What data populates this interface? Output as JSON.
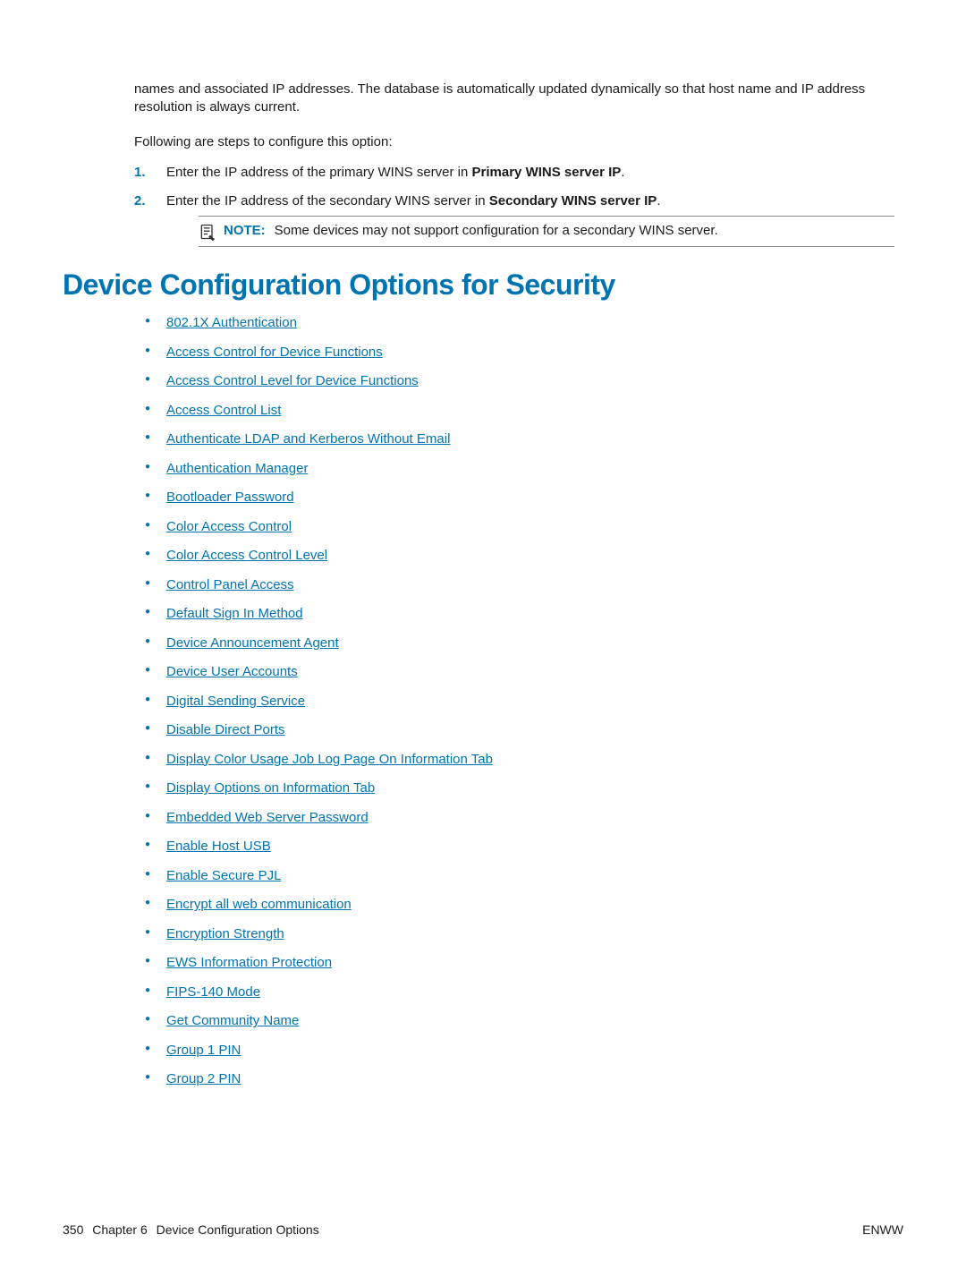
{
  "intro": {
    "paragraph1": "names and associated IP addresses. The database is automatically updated dynamically so that host name and IP address resolution is always current.",
    "paragraph2": "Following are steps to configure this option:"
  },
  "steps": [
    {
      "prefix": "Enter the IP address of the primary WINS server in ",
      "bold": "Primary WINS server IP",
      "suffix": "."
    },
    {
      "prefix": "Enter the IP address of the secondary WINS server in ",
      "bold": "Secondary WINS server IP",
      "suffix": "."
    }
  ],
  "note": {
    "label": "NOTE:",
    "text": "Some devices may not support configuration for a secondary WINS server."
  },
  "section_title": "Device Configuration Options for Security",
  "links": [
    "802.1X Authentication",
    "Access Control for Device Functions",
    "Access Control Level for Device Functions",
    "Access Control List",
    "Authenticate LDAP and Kerberos Without Email",
    "Authentication Manager",
    "Bootloader Password",
    "Color Access Control",
    "Color Access Control Level",
    "Control Panel Access",
    "Default Sign In Method",
    "Device Announcement Agent",
    "Device User Accounts",
    "Digital Sending Service",
    "Disable Direct Ports",
    "Display Color Usage Job Log Page On Information Tab",
    "Display Options on Information Tab",
    "Embedded Web Server Password",
    "Enable Host USB",
    "Enable Secure PJL",
    "Encrypt all web communication",
    "Encryption Strength",
    "EWS Information Protection",
    "FIPS-140 Mode",
    "Get Community Name",
    "Group 1 PIN",
    "Group 2 PIN"
  ],
  "footer": {
    "page_number": "350",
    "chapter": "Chapter 6",
    "chapter_title": "Device Configuration Options",
    "right": "ENWW"
  }
}
